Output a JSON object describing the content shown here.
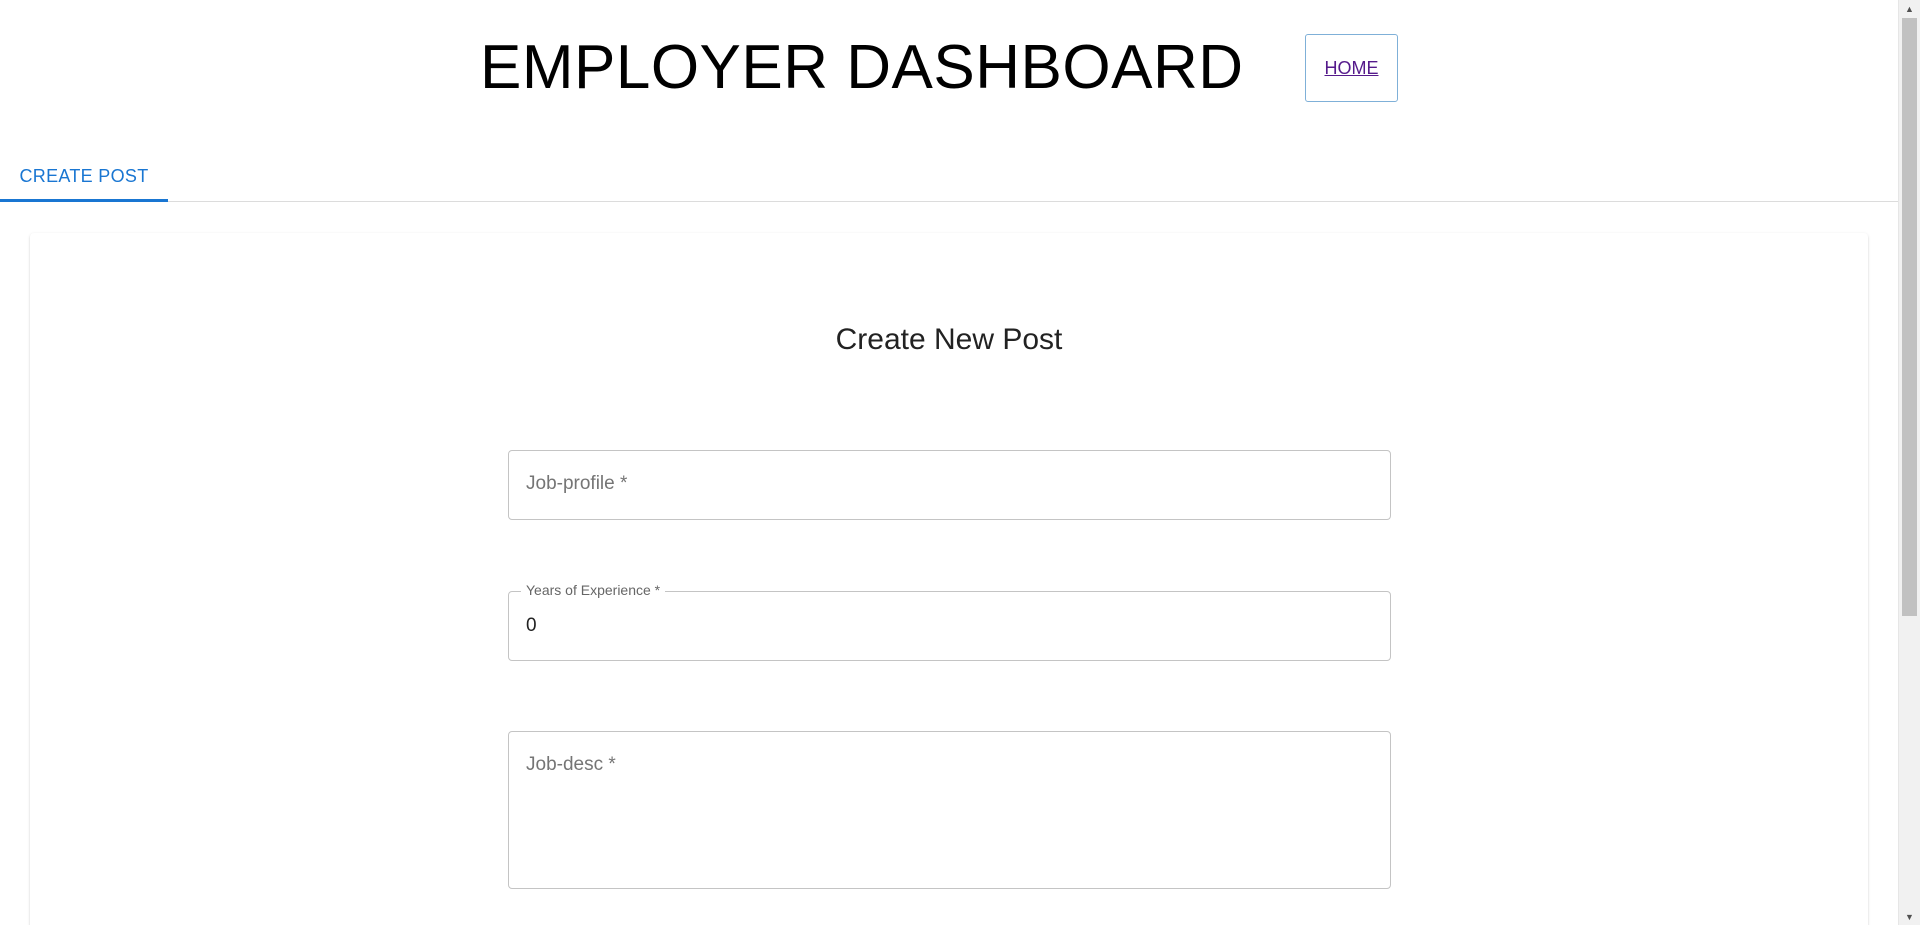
{
  "header": {
    "title": "EMPLOYER DASHBOARD",
    "home_link": "HOME"
  },
  "tabs": [
    {
      "label": "CREATE POST",
      "active": true
    }
  ],
  "colors": {
    "accent": "#1976d2",
    "link_visited": "#551a8b",
    "field_border": "#c4c4c4"
  },
  "form": {
    "heading": "Create New Post",
    "job_profile": {
      "label": "Job-profile *",
      "value": ""
    },
    "years_of_experience": {
      "label": "Years of Experience *",
      "value": "0"
    },
    "job_desc": {
      "label": "Job-desc *",
      "value": ""
    }
  },
  "scrollbar": {
    "up_icon": "triangle-up",
    "down_icon": "triangle-down"
  }
}
